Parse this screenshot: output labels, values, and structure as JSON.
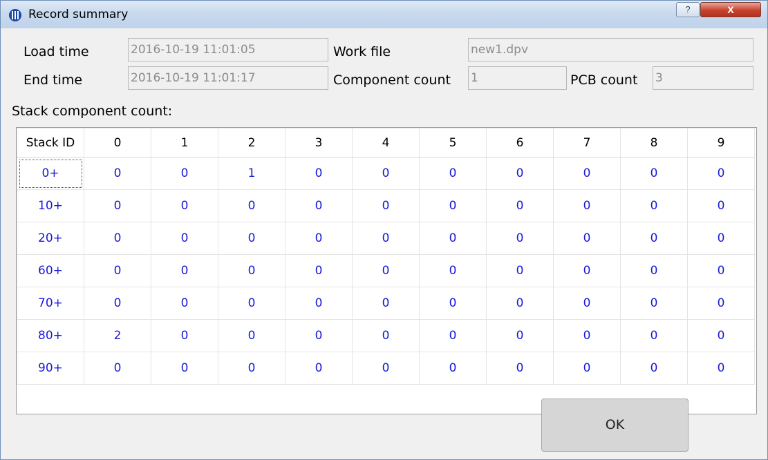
{
  "window": {
    "title": "Record summary",
    "help_label": "?",
    "close_label": "X"
  },
  "fields": {
    "load_time_label": "Load time",
    "load_time_value": "2016-10-19 11:01:05",
    "work_file_label": "Work file",
    "work_file_value": "new1.dpv",
    "end_time_label": "End time",
    "end_time_value": "2016-10-19 11:01:17",
    "component_count_label": "Component count",
    "component_count_value": "1",
    "pcb_count_label": "PCB count",
    "pcb_count_value": "3"
  },
  "stack": {
    "section_label": "Stack component count:",
    "headers": [
      "Stack ID",
      "0",
      "1",
      "2",
      "3",
      "4",
      "5",
      "6",
      "7",
      "8",
      "9"
    ],
    "rows": [
      {
        "id": "0+",
        "values": [
          "0",
          "0",
          "1",
          "0",
          "0",
          "0",
          "0",
          "0",
          "0",
          "0"
        ]
      },
      {
        "id": "10+",
        "values": [
          "0",
          "0",
          "0",
          "0",
          "0",
          "0",
          "0",
          "0",
          "0",
          "0"
        ]
      },
      {
        "id": "20+",
        "values": [
          "0",
          "0",
          "0",
          "0",
          "0",
          "0",
          "0",
          "0",
          "0",
          "0"
        ]
      },
      {
        "id": "60+",
        "values": [
          "0",
          "0",
          "0",
          "0",
          "0",
          "0",
          "0",
          "0",
          "0",
          "0"
        ]
      },
      {
        "id": "70+",
        "values": [
          "0",
          "0",
          "0",
          "0",
          "0",
          "0",
          "0",
          "0",
          "0",
          "0"
        ]
      },
      {
        "id": "80+",
        "values": [
          "2",
          "0",
          "0",
          "0",
          "0",
          "0",
          "0",
          "0",
          "0",
          "0"
        ]
      },
      {
        "id": "90+",
        "values": [
          "0",
          "0",
          "0",
          "0",
          "0",
          "0",
          "0",
          "0",
          "0",
          "0"
        ]
      }
    ]
  },
  "buttons": {
    "ok_label": "OK"
  },
  "colors": {
    "cell_text": "#1a1ad8",
    "close_button": "#c7422d",
    "title_icon": "#1b47a8"
  }
}
